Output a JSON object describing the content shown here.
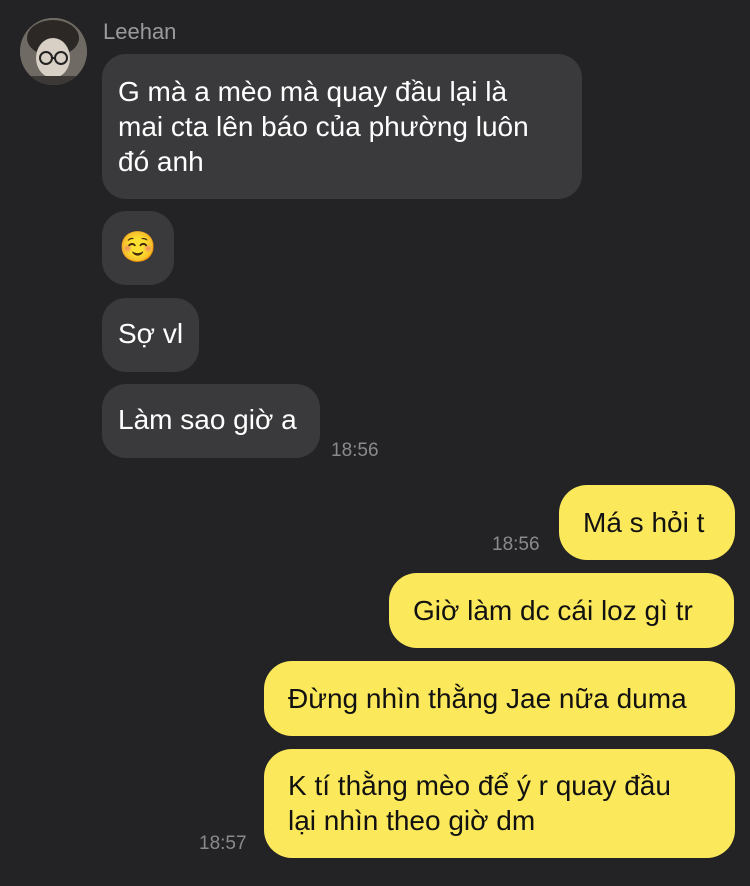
{
  "chat": {
    "sender_name": "Leehan",
    "incoming": [
      {
        "line1": "G mà a mèo mà quay đầu lại là",
        "line2": "mai cta lên báo của phường luôn",
        "line3": "đó anh"
      },
      {
        "emoji": "☺️"
      },
      {
        "text": "Sợ vl"
      },
      {
        "text": "Làm sao giờ a"
      }
    ],
    "incoming_time": "18:56",
    "outgoing": [
      {
        "text": "Má s hỏi t",
        "time": "18:56"
      },
      {
        "text": "Giờ làm dc cái loz gì tr"
      },
      {
        "text": "Đừng nhìn thằng Jae nữa duma"
      },
      {
        "line1": "K tí thằng mèo để ý r quay đầu",
        "line2": "lại nhìn theo giờ dm",
        "time": "18:57"
      }
    ]
  },
  "colors": {
    "background": "#232325",
    "incoming_bubble": "#3a3a3c",
    "outgoing_bubble": "#fce95b",
    "timestamp": "#8a8a8d"
  },
  "icons": {
    "avatar": "profile-photo"
  }
}
